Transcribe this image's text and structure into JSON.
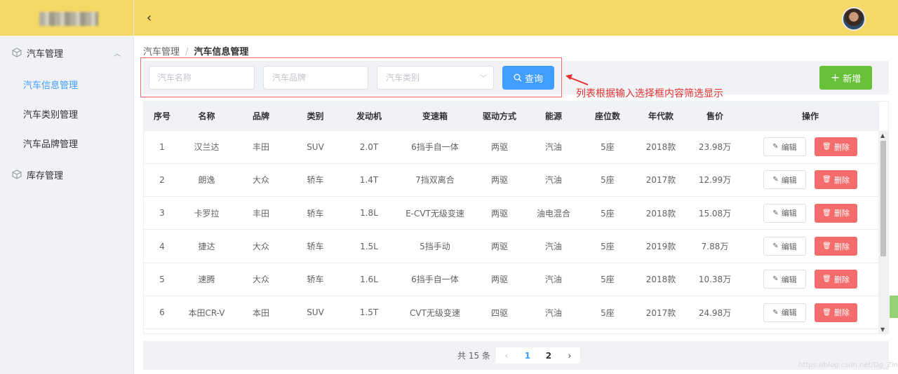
{
  "sidebar": {
    "groups": [
      {
        "label": "汽车管理",
        "items": [
          "汽车信息管理",
          "汽车类别管理",
          "汽车品牌管理"
        ]
      },
      {
        "label": "库存管理"
      }
    ]
  },
  "header": {
    "back_icon": "‹"
  },
  "breadcrumb": {
    "root": "汽车管理",
    "separator": "/",
    "current": "汽车信息管理"
  },
  "search": {
    "name_placeholder": "汽车名称",
    "brand_placeholder": "汽车品牌",
    "category_placeholder": "汽车类别",
    "query_label": "查询",
    "add_label": "新增"
  },
  "annotation": {
    "text": "列表根据输入选择框内容筛选显示",
    "color": "#e5302f"
  },
  "table": {
    "columns": [
      "序号",
      "名称",
      "品牌",
      "类别",
      "发动机",
      "变速箱",
      "驱动方式",
      "能源",
      "座位数",
      "年代款",
      "售价",
      "操作"
    ],
    "rows": [
      [
        "1",
        "汉兰达",
        "丰田",
        "SUV",
        "2.0T",
        "6挡手自一体",
        "两驱",
        "汽油",
        "5座",
        "2018款",
        "23.98万"
      ],
      [
        "2",
        "朗逸",
        "大众",
        "轿车",
        "1.4T",
        "7挡双离合",
        "两驱",
        "汽油",
        "5座",
        "2017款",
        "12.99万"
      ],
      [
        "3",
        "卡罗拉",
        "丰田",
        "轿车",
        "1.8L",
        "E-CVT无级变速",
        "两驱",
        "油电混合",
        "5座",
        "2018款",
        "15.08万"
      ],
      [
        "4",
        "捷达",
        "大众",
        "轿车",
        "1.5L",
        "5挡手动",
        "两驱",
        "汽油",
        "5座",
        "2019款",
        "7.88万"
      ],
      [
        "5",
        "速腾",
        "大众",
        "轿车",
        "1.6L",
        "6挡手自一体",
        "两驱",
        "汽油",
        "5座",
        "2018款",
        "10.38万"
      ],
      [
        "6",
        "本田CR-V",
        "本田",
        "SUV",
        "1.5T",
        "CVT无级变速",
        "四驱",
        "汽油",
        "5座",
        "2017款",
        "24.98万"
      ]
    ],
    "edit_label": "编辑",
    "delete_label": "删除"
  },
  "pagination": {
    "total_text": "共 15 条",
    "pages": [
      "1",
      "2"
    ],
    "current_page": "1"
  },
  "watermark": "https://blog.csdn.net/Dg_Zing",
  "colors": {
    "primary": "#409eff",
    "success": "#67c23a",
    "danger": "#f56c6c",
    "header_bg": "#f5d865"
  }
}
